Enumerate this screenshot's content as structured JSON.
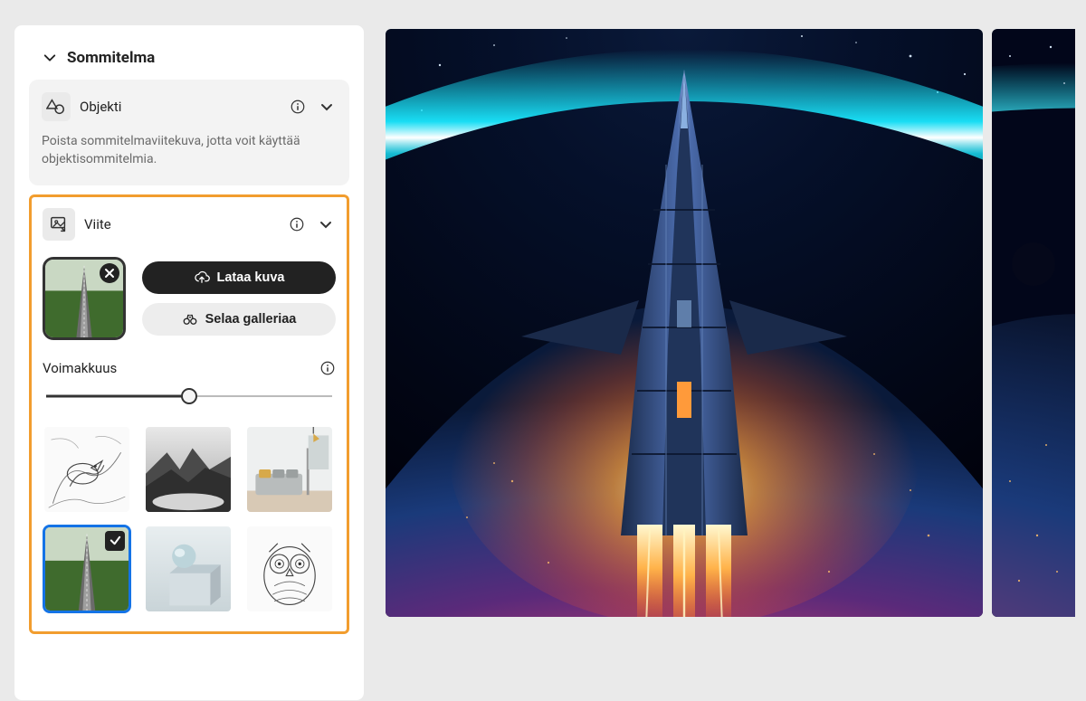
{
  "section": {
    "title": "Sommitelma"
  },
  "object_card": {
    "label": "Objekti",
    "hint": "Poista sommitelmaviitekuva, jotta voit käyttää objektisommitelmia."
  },
  "reference": {
    "label": "Viite",
    "upload_btn": "Lataa kuva",
    "browse_btn": "Selaa galleriaa"
  },
  "strength": {
    "label": "Voimakkuus",
    "value_percent": 50
  },
  "gallery": {
    "items": [
      {
        "name": "bird-sketch"
      },
      {
        "name": "mountain-bw"
      },
      {
        "name": "living-room"
      },
      {
        "name": "road-aerial",
        "selected": true
      },
      {
        "name": "geometric-3d"
      },
      {
        "name": "owl-mandala"
      }
    ]
  },
  "colors": {
    "highlight": "#f29d2e",
    "selection": "#1473e6"
  }
}
